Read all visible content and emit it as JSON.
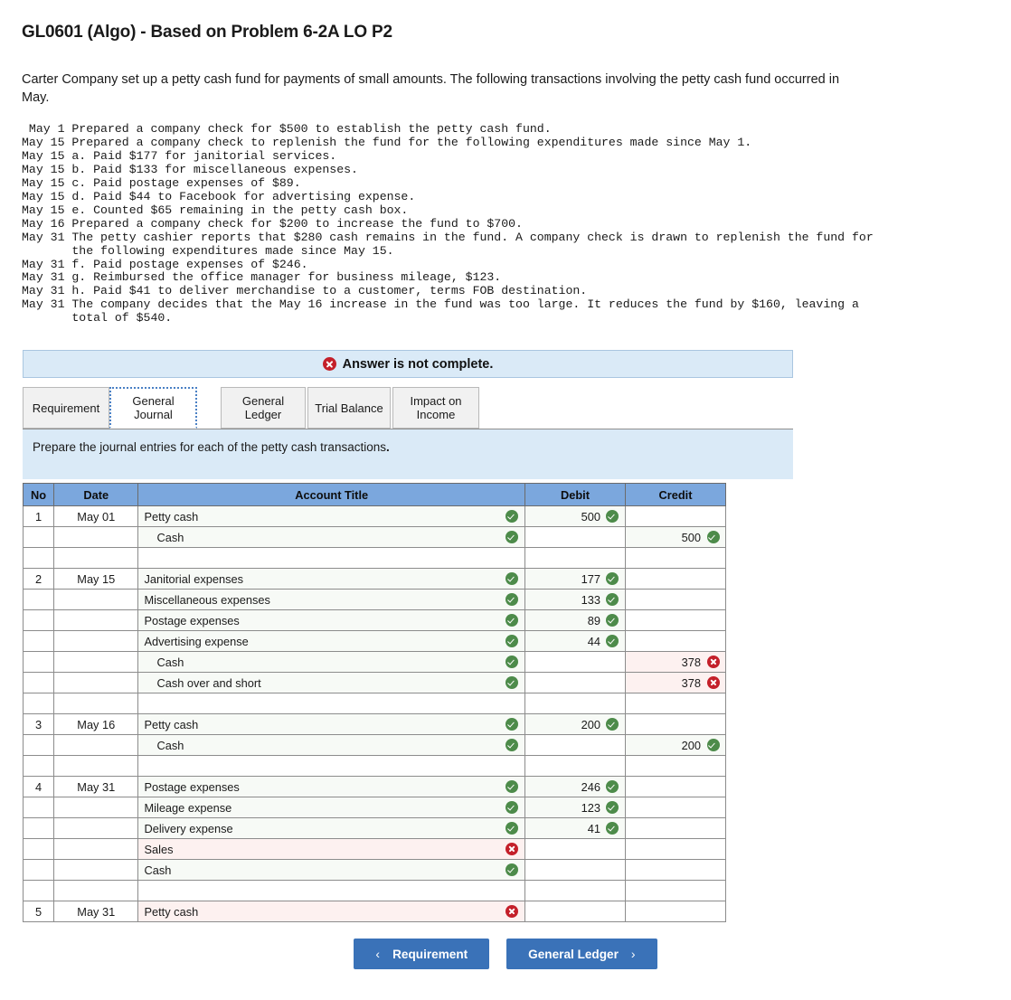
{
  "problem": {
    "title": "GL0601 (Algo) - Based on Problem 6-2A LO P2",
    "intro": "Carter Company set up a petty cash fund for payments of small amounts. The following transactions involving the petty cash fund occurred in May.",
    "transactions": [
      " May 1 Prepared a company check for $500 to establish the petty cash fund.",
      "May 15 Prepared a company check to replenish the fund for the following expenditures made since May 1.",
      "May 15 a. Paid $177 for janitorial services.",
      "May 15 b. Paid $133 for miscellaneous expenses.",
      "May 15 c. Paid postage expenses of $89.",
      "May 15 d. Paid $44 to Facebook for advertising expense.",
      "May 15 e. Counted $65 remaining in the petty cash box.",
      "May 16 Prepared a company check for $200 to increase the fund to $700.",
      "May 31 The petty cashier reports that $280 cash remains in the fund. A company check is drawn to replenish the fund for",
      "       the following expenditures made since May 15.",
      "May 31 f. Paid postage expenses of $246.",
      "May 31 g. Reimbursed the office manager for business mileage, $123.",
      "May 31 h. Paid $41 to deliver merchandise to a customer, terms FOB destination.",
      "May 31 The company decides that the May 16 increase in the fund was too large. It reduces the fund by $160, leaving a",
      "       total of $540."
    ]
  },
  "alert": {
    "icon": "error-circle-icon",
    "text": "Answer is not complete."
  },
  "tabs": [
    {
      "label": "Requirement",
      "active": false
    },
    {
      "label": "General\nJournal",
      "line1": "General",
      "line2": "Journal",
      "active": true
    },
    {
      "label": "General\nLedger",
      "line1": "General",
      "line2": "Ledger",
      "active": false
    },
    {
      "label": "Trial Balance",
      "active": false
    },
    {
      "label": "Impact on\nIncome",
      "line1": "Impact on",
      "line2": "Income",
      "active": false
    }
  ],
  "instruction": {
    "text_plain": "Prepare the journal entries for each of the petty cash transactions",
    "text_bold": "."
  },
  "journal": {
    "columns": [
      "No",
      "Date",
      "Account Title",
      "Debit",
      "Credit"
    ],
    "rows": [
      {
        "type": "entry",
        "no": "1",
        "date": "May 01",
        "account": "Petty cash",
        "indent": false,
        "account_status": "ok",
        "debit": "500",
        "debit_status": "ok",
        "credit": "",
        "credit_status": ""
      },
      {
        "type": "entry",
        "no": "",
        "date": "",
        "account": "Cash",
        "indent": true,
        "account_status": "ok",
        "debit": "",
        "debit_status": "",
        "credit": "500",
        "credit_status": "ok"
      },
      {
        "type": "spacer"
      },
      {
        "type": "entry",
        "no": "2",
        "date": "May 15",
        "account": "Janitorial expenses",
        "indent": false,
        "account_status": "ok",
        "debit": "177",
        "debit_status": "ok",
        "credit": "",
        "credit_status": ""
      },
      {
        "type": "entry",
        "no": "",
        "date": "",
        "account": "Miscellaneous expenses",
        "indent": false,
        "account_status": "ok",
        "debit": "133",
        "debit_status": "ok",
        "credit": "",
        "credit_status": ""
      },
      {
        "type": "entry",
        "no": "",
        "date": "",
        "account": "Postage expenses",
        "indent": false,
        "account_status": "ok",
        "debit": "89",
        "debit_status": "ok",
        "credit": "",
        "credit_status": ""
      },
      {
        "type": "entry",
        "no": "",
        "date": "",
        "account": "Advertising expense",
        "indent": false,
        "account_status": "ok",
        "debit": "44",
        "debit_status": "ok",
        "credit": "",
        "credit_status": ""
      },
      {
        "type": "entry",
        "no": "",
        "date": "",
        "account": "Cash",
        "indent": true,
        "account_status": "ok",
        "debit": "",
        "debit_status": "",
        "credit": "378",
        "credit_status": "error"
      },
      {
        "type": "entry",
        "no": "",
        "date": "",
        "account": "Cash over and short",
        "indent": true,
        "account_status": "ok",
        "debit": "",
        "debit_status": "",
        "credit": "378",
        "credit_status": "error"
      },
      {
        "type": "spacer"
      },
      {
        "type": "entry",
        "no": "3",
        "date": "May 16",
        "account": "Petty cash",
        "indent": false,
        "account_status": "ok",
        "debit": "200",
        "debit_status": "ok",
        "credit": "",
        "credit_status": ""
      },
      {
        "type": "entry",
        "no": "",
        "date": "",
        "account": "Cash",
        "indent": true,
        "account_status": "ok",
        "debit": "",
        "debit_status": "",
        "credit": "200",
        "credit_status": "ok"
      },
      {
        "type": "spacer"
      },
      {
        "type": "entry",
        "no": "4",
        "date": "May 31",
        "account": "Postage expenses",
        "indent": false,
        "account_status": "ok",
        "debit": "246",
        "debit_status": "ok",
        "credit": "",
        "credit_status": ""
      },
      {
        "type": "entry",
        "no": "",
        "date": "",
        "account": "Mileage expense",
        "indent": false,
        "account_status": "ok",
        "debit": "123",
        "debit_status": "ok",
        "credit": "",
        "credit_status": ""
      },
      {
        "type": "entry",
        "no": "",
        "date": "",
        "account": "Delivery expense",
        "indent": false,
        "account_status": "ok",
        "debit": "41",
        "debit_status": "ok",
        "credit": "",
        "credit_status": ""
      },
      {
        "type": "entry",
        "no": "",
        "date": "",
        "account": "Sales",
        "indent": false,
        "account_status": "error",
        "debit": "",
        "debit_status": "",
        "credit": "",
        "credit_status": ""
      },
      {
        "type": "entry",
        "no": "",
        "date": "",
        "account": "Cash",
        "indent": false,
        "account_status": "ok",
        "debit": "",
        "debit_status": "",
        "credit": "",
        "credit_status": ""
      },
      {
        "type": "spacer"
      },
      {
        "type": "entry",
        "no": "5",
        "date": "May 31",
        "account": "Petty cash",
        "indent": false,
        "account_status": "error",
        "debit": "",
        "debit_status": "",
        "credit": "",
        "credit_status": ""
      }
    ]
  },
  "footer": {
    "prev_label": "Requirement",
    "prev_chevron": "‹",
    "next_label": "General Ledger",
    "next_chevron": "›"
  },
  "colors": {
    "accent_blue": "#3a72b8",
    "header_blue": "#7ba7dd",
    "panel_blue": "#daeaf7",
    "ok_green": "#4d8b4a",
    "error_red": "#c4202a",
    "error_bg": "#fdf1f0",
    "ok_bg": "#f7faf6"
  }
}
